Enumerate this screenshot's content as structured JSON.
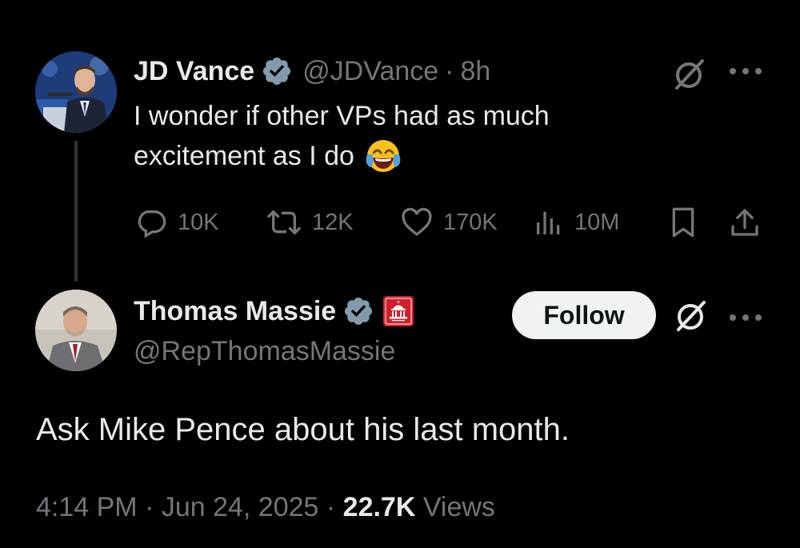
{
  "colors": {
    "background": "#000000",
    "text_primary": "#e7e9ea",
    "text_secondary": "#71767b",
    "verified_badge": "#829aab",
    "follow_button_bg": "#eff3f4",
    "capitol_badge": "#d11f2c"
  },
  "original_tweet": {
    "name": "JD Vance",
    "handle": "@JDVance",
    "separator": "·",
    "time_ago": "8h",
    "text_line1": "I wonder if other VPs had as much",
    "text_line2": "excitement as I do",
    "emoji": "😂",
    "actions": {
      "replies": "10K",
      "reposts": "12K",
      "likes": "170K",
      "views": "10M"
    },
    "icons": [
      "verified-badge-icon",
      "grok-icon",
      "more-icon",
      "reply-icon",
      "repost-icon",
      "like-icon",
      "views-icon",
      "bookmark-icon",
      "share-icon"
    ]
  },
  "reply_tweet": {
    "name": "Thomas Massie",
    "handle": "@RepThomasMassie",
    "follow_label": "Follow",
    "text": "Ask Mike Pence about his last month.",
    "timestamp": "4:14 PM · Jun 24, 2025 · ",
    "views_count": "22.7K",
    "views_label": " Views",
    "icons": [
      "verified-badge-icon",
      "us-capitol-badge-icon",
      "grok-icon",
      "more-icon"
    ]
  }
}
